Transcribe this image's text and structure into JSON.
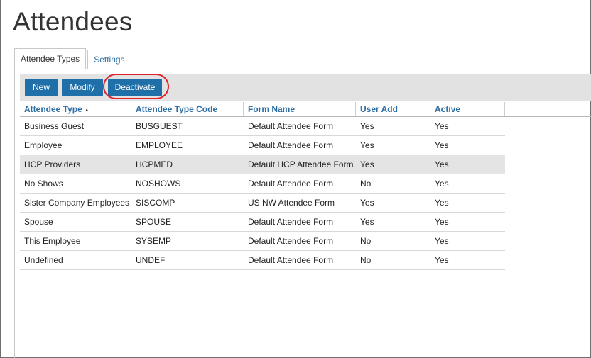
{
  "page": {
    "title": "Attendees"
  },
  "tabs": [
    {
      "label": "Attendee Types",
      "active": true
    },
    {
      "label": "Settings",
      "active": false
    }
  ],
  "toolbar": {
    "new_label": "New",
    "modify_label": "Modify",
    "deactivate_label": "Deactivate"
  },
  "colors": {
    "button": "#1f6fa8",
    "header_link": "#2d6da3",
    "highlight": "#e0202a",
    "toolbar_bg": "#e2e2e2",
    "selected_row": "#e4e4e4"
  },
  "table": {
    "columns": [
      "Attendee Type",
      "Attendee Type Code",
      "Form Name",
      "User Add",
      "Active"
    ],
    "sort_indicator": "▲",
    "rows": [
      [
        "Business Guest",
        "BUSGUEST",
        "Default Attendee Form",
        "Yes",
        "Yes"
      ],
      [
        "Employee",
        "EMPLOYEE",
        "Default Attendee Form",
        "Yes",
        "Yes"
      ],
      [
        "HCP Providers",
        "HCPMED",
        "Default HCP Attendee Form",
        "Yes",
        "Yes"
      ],
      [
        "No Shows",
        "NOSHOWS",
        "Default Attendee Form",
        "No",
        "Yes"
      ],
      [
        "Sister Company Employees",
        "SISCOMP",
        "US NW Attendee Form",
        "Yes",
        "Yes"
      ],
      [
        "Spouse",
        "SPOUSE",
        "Default Attendee Form",
        "Yes",
        "Yes"
      ],
      [
        "This Employee",
        "SYSEMP",
        "Default Attendee Form",
        "No",
        "Yes"
      ],
      [
        "Undefined",
        "UNDEF",
        "Default Attendee Form",
        "No",
        "Yes"
      ]
    ],
    "selected_row": 2
  }
}
